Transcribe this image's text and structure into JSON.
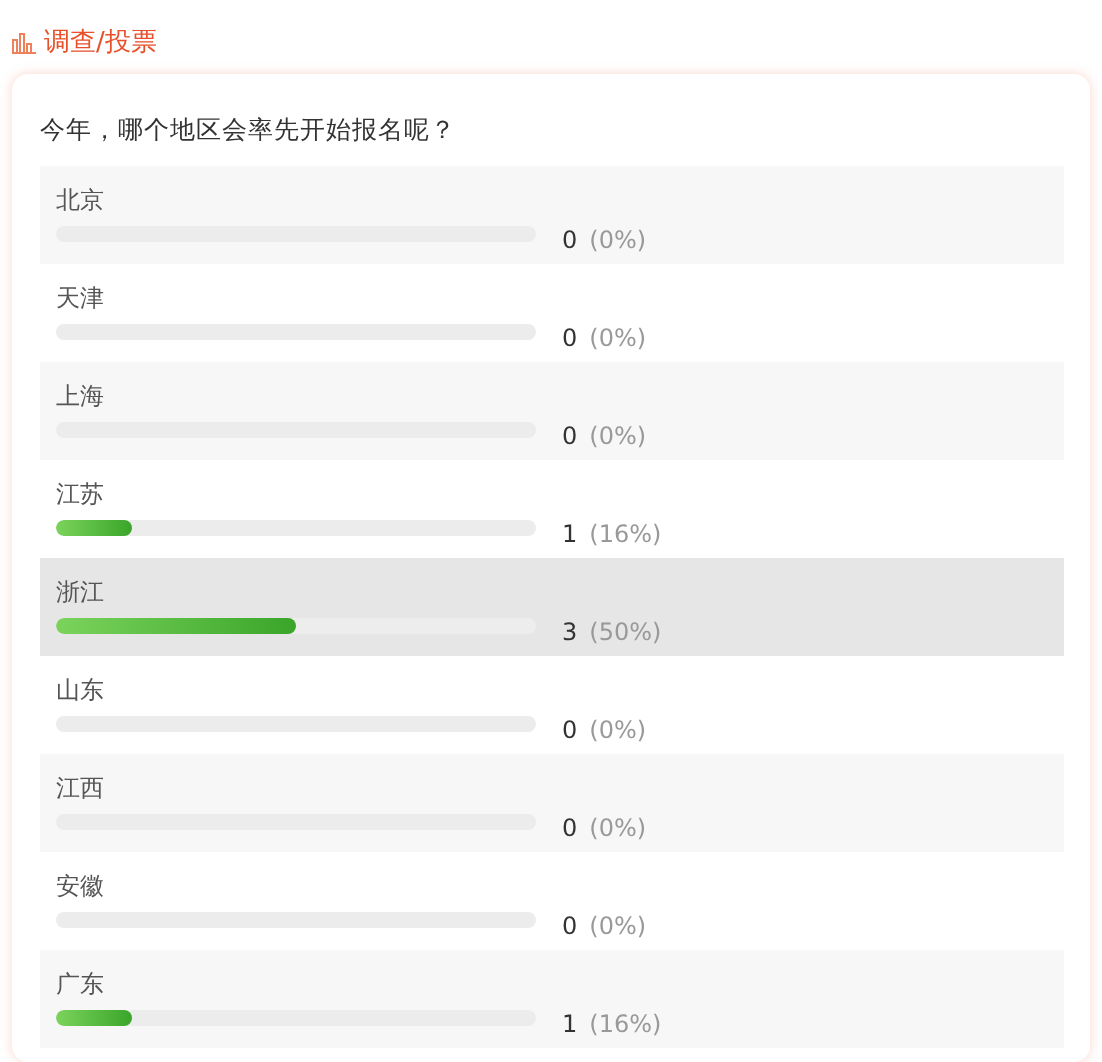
{
  "header": {
    "title": "调查/投票"
  },
  "poll": {
    "question": "今年，哪个地区会率先开始报名呢？",
    "options": [
      {
        "label": "北京",
        "level": 0,
        "count": "0",
        "percent": "(0%)",
        "selected": false
      },
      {
        "label": "天津",
        "level": 0,
        "count": "0",
        "percent": "(0%)",
        "selected": false
      },
      {
        "label": "上海",
        "level": 0,
        "count": "0",
        "percent": "(0%)",
        "selected": false
      },
      {
        "label": "江苏",
        "level": 0.16,
        "count": "1",
        "percent": "(16%)",
        "selected": false
      },
      {
        "label": "浙江",
        "level": 0.5,
        "count": "3",
        "percent": "(50%)",
        "selected": true
      },
      {
        "label": "山东",
        "level": 0,
        "count": "0",
        "percent": "(0%)",
        "selected": false
      },
      {
        "label": "江西",
        "level": 0,
        "count": "0",
        "percent": "(0%)",
        "selected": false
      },
      {
        "label": "安徽",
        "level": 0,
        "count": "0",
        "percent": "(0%)",
        "selected": false
      },
      {
        "label": "广东",
        "level": 0.16,
        "count": "1",
        "percent": "(16%)",
        "selected": false
      }
    ]
  }
}
